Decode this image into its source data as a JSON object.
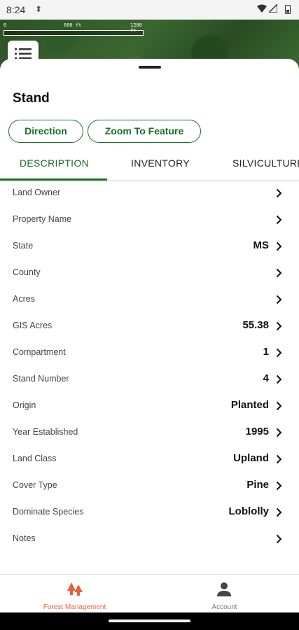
{
  "status_bar": {
    "time": "8:24"
  },
  "map": {
    "scale_labels": [
      "0",
      "600 ft",
      "1200 ft"
    ]
  },
  "sheet": {
    "title": "Stand",
    "actions": {
      "direction": "Direction",
      "zoom": "Zoom To Feature"
    },
    "tabs": [
      {
        "label": "DESCRIPTION",
        "active": true
      },
      {
        "label": "INVENTORY",
        "active": false
      },
      {
        "label": "SILVICULTURE",
        "active": false
      }
    ],
    "rows": [
      {
        "label": "Land Owner",
        "value": ""
      },
      {
        "label": "Property Name",
        "value": ""
      },
      {
        "label": "State",
        "value": "MS"
      },
      {
        "label": "County",
        "value": ""
      },
      {
        "label": "Acres",
        "value": ""
      },
      {
        "label": "GIS Acres",
        "value": "55.38"
      },
      {
        "label": "Compartment",
        "value": "1"
      },
      {
        "label": "Stand Number",
        "value": "4"
      },
      {
        "label": "Origin",
        "value": "Planted"
      },
      {
        "label": "Year Established",
        "value": "1995"
      },
      {
        "label": "Land Class",
        "value": "Upland"
      },
      {
        "label": "Cover Type",
        "value": "Pine"
      },
      {
        "label": "Dominate Species",
        "value": "Loblolly"
      },
      {
        "label": "Notes",
        "value": ""
      }
    ]
  },
  "bottom_nav": {
    "items": [
      {
        "label": "Forest Management",
        "icon": "trees-icon",
        "active": true
      },
      {
        "label": "Account",
        "icon": "person-icon",
        "active": false
      }
    ]
  },
  "colors": {
    "accent_green": "#1b6d2b",
    "nav_active": "#e8613c"
  }
}
